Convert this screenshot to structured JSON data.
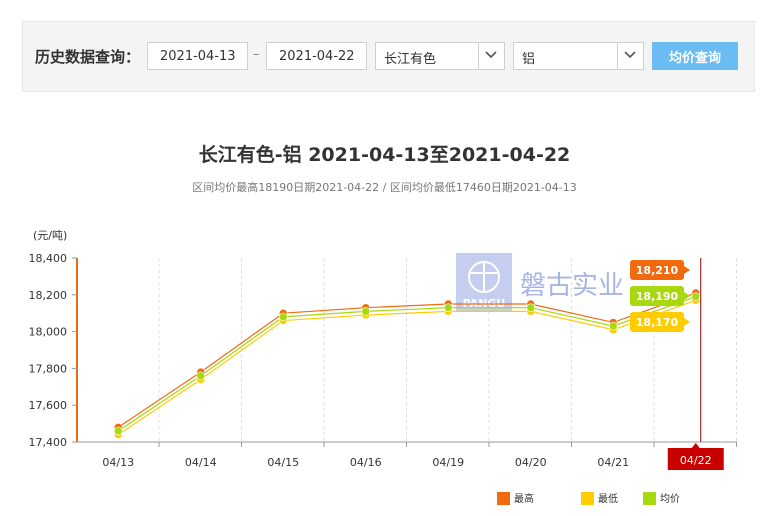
{
  "query": {
    "label": "历史数据查询：",
    "start_date": "2021-04-13",
    "separator": "–",
    "end_date": "2021-04-22",
    "market": "长江有色",
    "metal": "铝",
    "button": "均价查询"
  },
  "watermark": {
    "logo_text": "PANGU",
    "company": "磐古实业"
  },
  "chart_data": {
    "type": "line",
    "title": "长江有色-铝 2021-04-13至2021-04-22",
    "subtitle": "区间均价最高18190日期2021-04-22 / 区间均价最低17460日期2021-04-13",
    "ylabel": "(元/吨)",
    "ylim": [
      17400,
      18400
    ],
    "yticks": [
      "17,400",
      "17,600",
      "17,800",
      "18,000",
      "18,200",
      "18,400"
    ],
    "categories": [
      "04/13",
      "04/14",
      "04/15",
      "04/16",
      "04/19",
      "04/20",
      "04/21",
      "04/22"
    ],
    "highlight_category": "04/22",
    "series": [
      {
        "name": "最高",
        "color": "#f26a10",
        "values": [
          17480,
          17780,
          18100,
          18130,
          18150,
          18150,
          18050,
          18210
        ],
        "end_label": "18,210"
      },
      {
        "name": "最低",
        "color": "#ffcc00",
        "values": [
          17440,
          17740,
          18060,
          18090,
          18110,
          18110,
          18010,
          18170
        ],
        "end_label": "18,170"
      },
      {
        "name": "均价",
        "color": "#a8d80f",
        "values": [
          17460,
          17760,
          18080,
          18110,
          18130,
          18130,
          18030,
          18190
        ],
        "end_label": "18,190"
      }
    ],
    "legend_position": "bottom-right",
    "grid": "vertical-dashed",
    "cursor_color": "#8b0000",
    "highlight_color": "#c80000"
  }
}
